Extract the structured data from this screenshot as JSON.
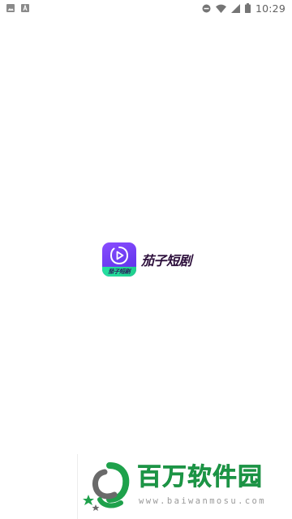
{
  "status_bar": {
    "time": "10:29",
    "left_icons": [
      "image-notification-icon",
      "a-notification-icon"
    ],
    "right_icons": [
      "do-not-disturb-icon",
      "wifi-icon",
      "cellular-signal-icon",
      "battery-icon"
    ]
  },
  "splash": {
    "app_name": "茄子短剧",
    "icon_label": "茄子短剧",
    "icon_colors": {
      "primary": "#7b45f5",
      "band": "#25e0a0"
    }
  },
  "watermark": {
    "title": "百万软件园",
    "url": "www.baiwanmosu.com",
    "color": "#1ea14b"
  }
}
